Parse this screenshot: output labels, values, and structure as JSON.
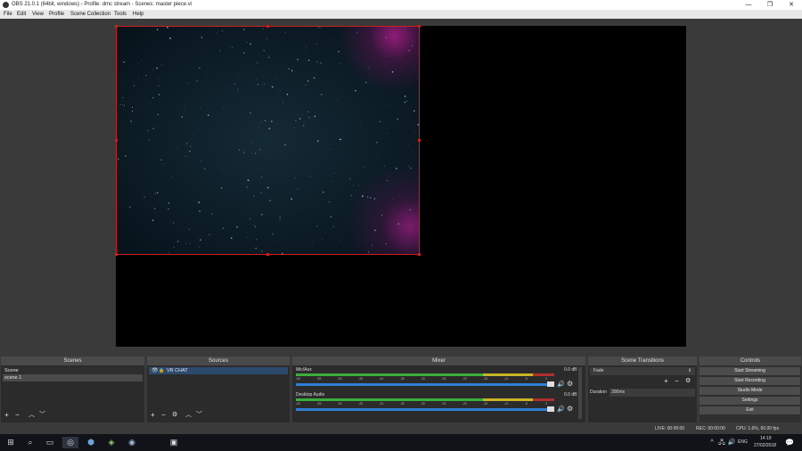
{
  "window": {
    "title": "OBS 21.0.1 (64bit, windows) - Profile: dmc stream - Scenes: master piece.vi"
  },
  "menu": [
    "File",
    "Edit",
    "View",
    "Profile",
    "Scene Collection",
    "Tools",
    "Help"
  ],
  "scenes": {
    "header": "Scenes",
    "items": [
      "Scene",
      "scene 1"
    ]
  },
  "sources": {
    "header": "Sources",
    "items": [
      "VR CHAT"
    ]
  },
  "mixer": {
    "header": "Mixer",
    "channels": [
      {
        "name": "Mic/Aux",
        "db": "0.0 dB",
        "volume": 1.0
      },
      {
        "name": "Desktop Audio",
        "db": "0.0 dB",
        "volume": 1.0
      }
    ],
    "scale": [
      "-60",
      "-55",
      "-50",
      "-45",
      "-40",
      "-35",
      "-30",
      "-25",
      "-20",
      "-15",
      "-10",
      "-5",
      "0"
    ]
  },
  "transitions": {
    "header": "Scene Transitions",
    "selected": "Fade",
    "duration_label": "Duration",
    "duration_value": "300ms"
  },
  "controls": {
    "header": "Controls",
    "buttons": [
      "Start Streaming",
      "Start Recording",
      "Studio Mode",
      "Settings",
      "Exit"
    ]
  },
  "status": {
    "live": "LIVE: 00:00:00",
    "rec": "REC: 00:00:00",
    "cpu": "CPU: 1.6%, 60.00 fps"
  },
  "taskbar": {
    "time": "14:19",
    "date": "27/02/2018",
    "lang": "ENG"
  },
  "colors": {
    "accent_red": "#d01c1c",
    "meter_green": "#3cae3c",
    "meter_yellow": "#c8b428",
    "slider_blue": "#2e7fd6"
  }
}
